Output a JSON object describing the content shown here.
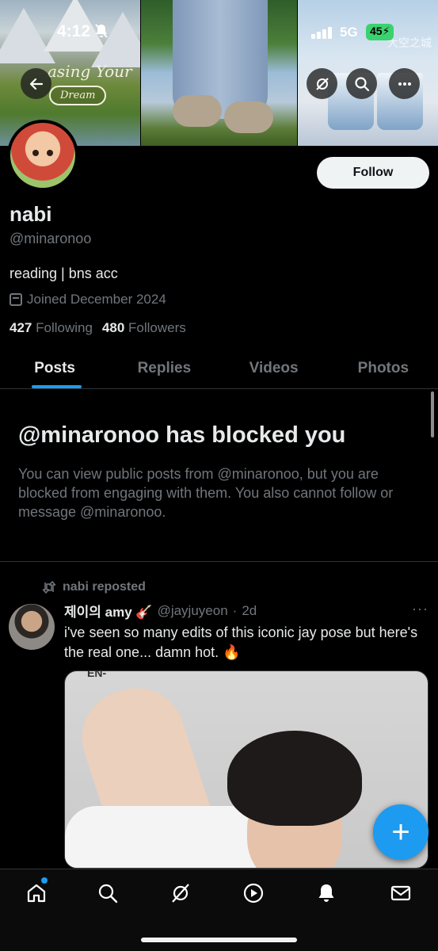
{
  "status_bar": {
    "time": "4:12",
    "network": "5G",
    "battery": "45"
  },
  "banner": {
    "script_text": "asing Your",
    "dream_text": "Dream",
    "watermark": "大空之城"
  },
  "profile": {
    "name": "nabi",
    "handle": "@minaronoo",
    "bio": "reading | bns acc",
    "joined": "Joined December 2024",
    "following_count": "427",
    "following_label": "Following",
    "followers_count": "480",
    "followers_label": "Followers",
    "follow_button": "Follow"
  },
  "tabs": [
    {
      "label": "Posts",
      "active": true
    },
    {
      "label": "Replies",
      "active": false
    },
    {
      "label": "Videos",
      "active": false
    },
    {
      "label": "Photos",
      "active": false
    }
  ],
  "blocked": {
    "title": "@minaronoo has blocked you",
    "body": "You can view public posts from @minaronoo, but you are blocked from engaging with them. You also cannot follow or message @minaronoo."
  },
  "post": {
    "repost_label": "nabi reposted",
    "author": "제이의 amy 🎸",
    "handle": "@jayjuyeon",
    "separator": "·",
    "time": "2d",
    "text": "i've seen so many edits of this iconic jay pose but here's the real one... damn hot. 🔥",
    "media_mark": "EN-"
  },
  "fab_label": "+",
  "bottom_nav": [
    "home-icon",
    "search-icon",
    "grok-icon",
    "play-icon",
    "bell-icon",
    "mail-icon"
  ],
  "colors": {
    "accent": "#1d9bf0",
    "background": "#000000",
    "text_primary": "#e7e9ea",
    "text_secondary": "#71767b"
  }
}
